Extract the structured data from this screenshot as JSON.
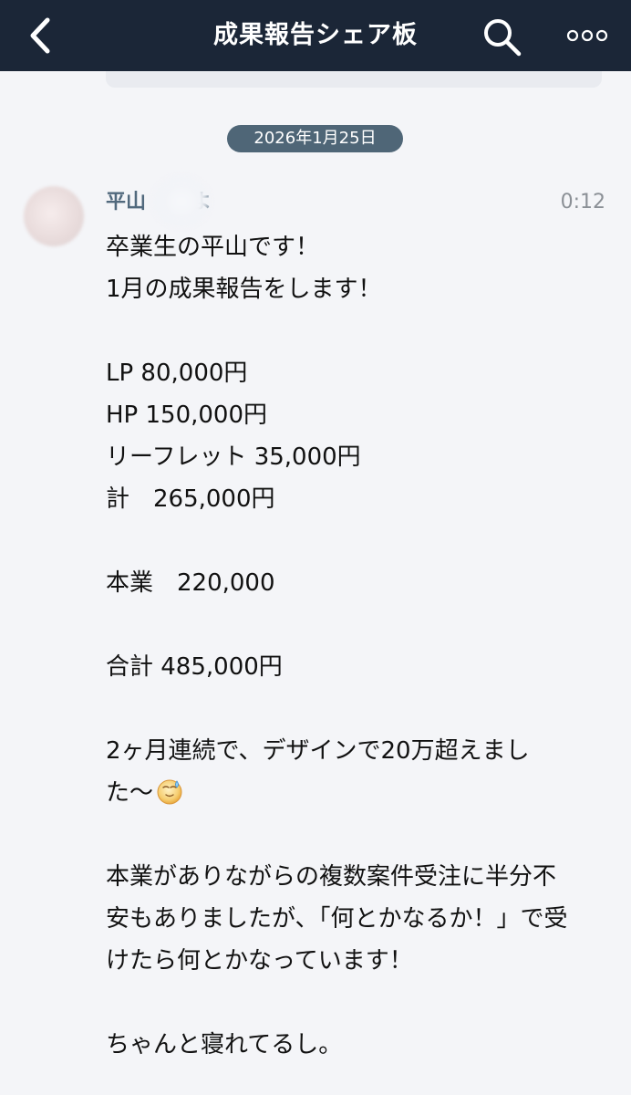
{
  "header": {
    "title": "成果報告シェア板",
    "back_icon": "chevron-left-icon",
    "search_icon": "search-icon",
    "more_icon": "more-horizontal-icon"
  },
  "date_separator": "2026年1月25日",
  "post": {
    "sender_part1": "平山",
    "sender_part2": "よ",
    "time": "0:12",
    "lines": [
      "卒業生の平山です！",
      "1月の成果報告をします！",
      "",
      "LP 80,000円",
      "HP 150,000円",
      "リーフレット 35,000円",
      "計　265,000円",
      "",
      "本業　220,000",
      "",
      "合計 485,000円",
      "",
      "2ヶ月連続で、デザインで20万超えまし",
      "た〜",
      "",
      "本業がありながらの複数案件受注に半分不",
      "安もありましたが、「何とかなるか！」で受",
      "けたら何とかなっています！",
      "",
      "ちゃんと寝れてるし。"
    ],
    "emoji_icon": "sweat-smile-face-icon"
  },
  "colors": {
    "topbar": "#1b2637",
    "background": "#f4f5f8",
    "date_pill": "#4f6677",
    "sender": "#51697d",
    "time": "#8b9096"
  }
}
